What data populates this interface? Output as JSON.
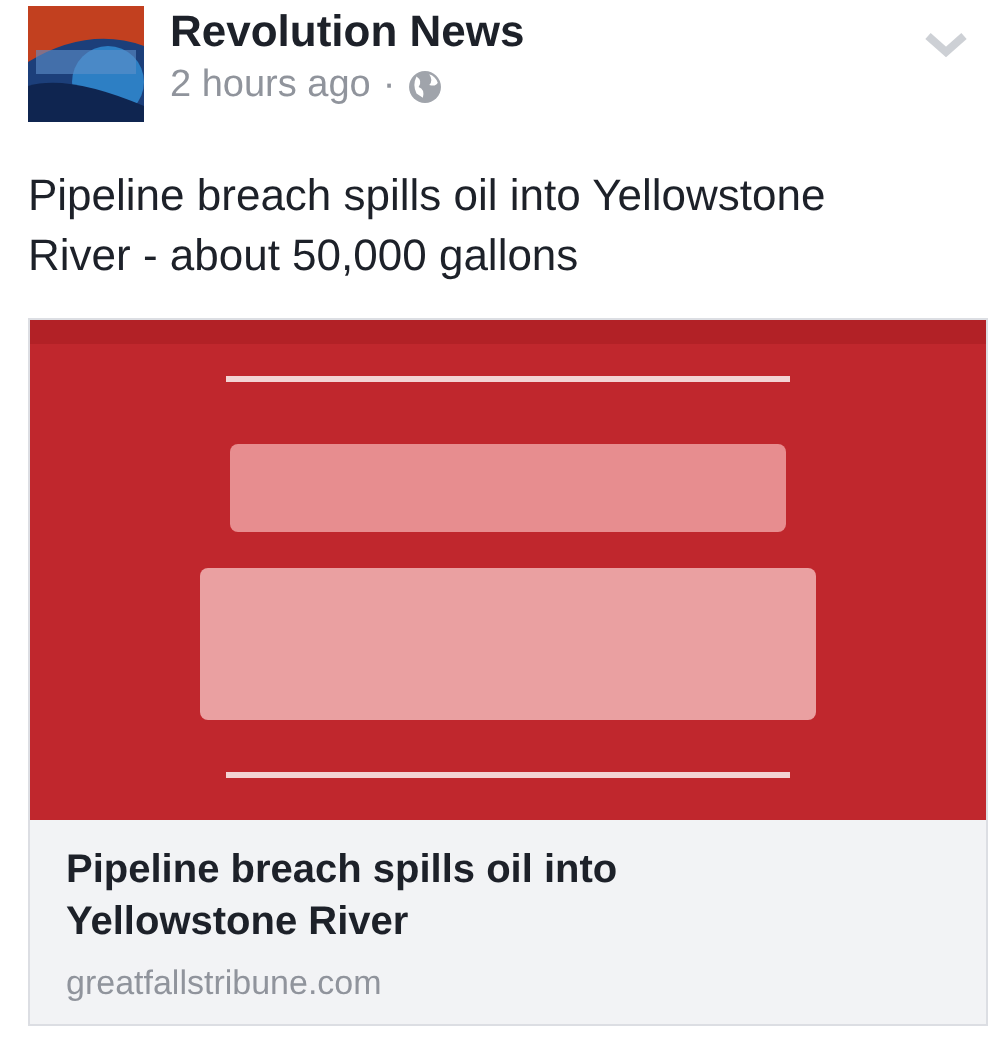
{
  "post": {
    "author": "Revolution News",
    "time": "2 hours ago",
    "separator": "·",
    "text": "Pipeline breach spills oil into Yellowstone River - about 50,000 gallons"
  },
  "link": {
    "title": "Pipeline breach spills oil into Yellowstone River",
    "domain": "greatfallstribune.com"
  }
}
